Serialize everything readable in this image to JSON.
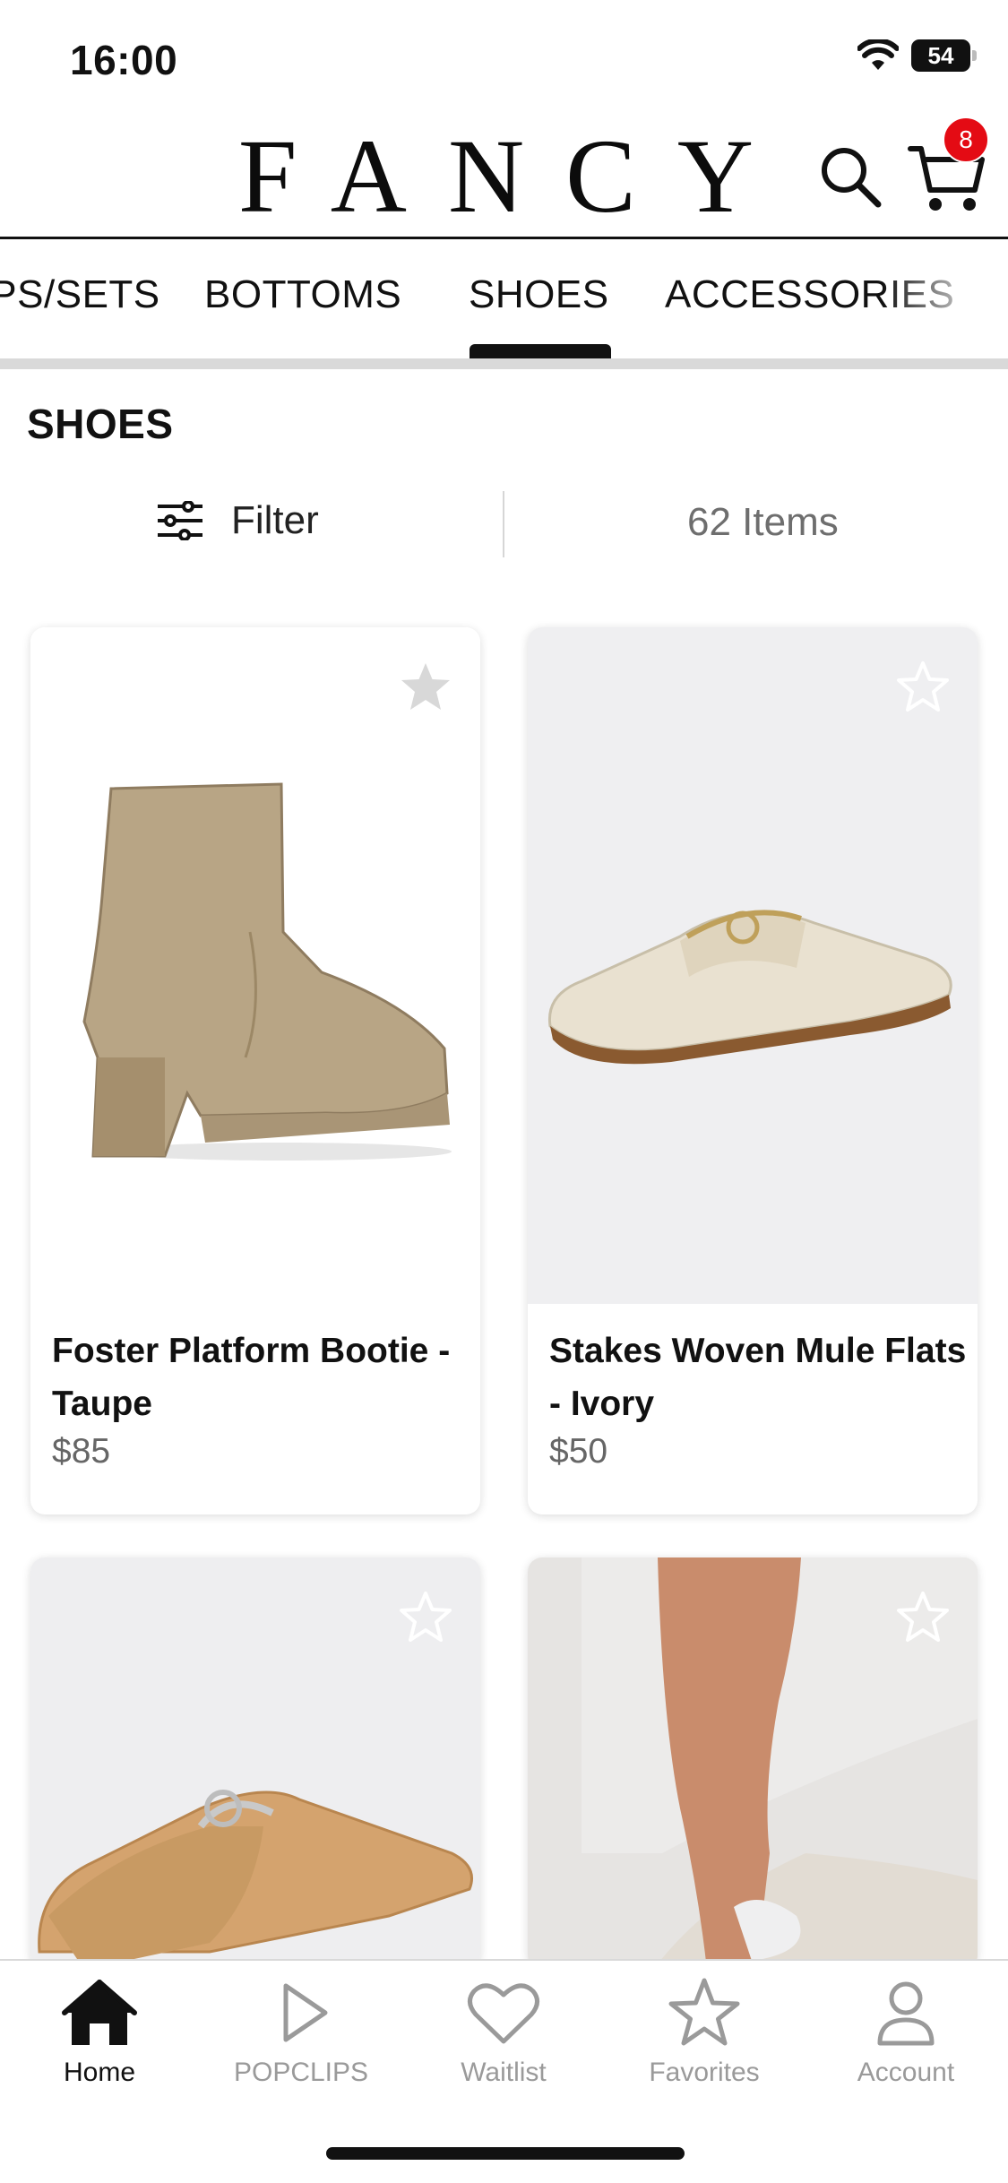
{
  "status_bar": {
    "time": "16:00",
    "battery": "54"
  },
  "header": {
    "logo": "FANCY",
    "cart_count": "8"
  },
  "tabs": [
    {
      "label": "TOPS/SETS"
    },
    {
      "label": "BOTTOMS"
    },
    {
      "label": "SHOES",
      "active": true
    },
    {
      "label": "ACCESSORIES"
    }
  ],
  "section": {
    "title": "SHOES",
    "filter_label": "Filter",
    "item_count": "62 Items"
  },
  "products": [
    {
      "name": "Foster Platform Bootie - Taupe",
      "price": "$85"
    },
    {
      "name": "Stakes Woven Mule Flats - Ivory",
      "price": "$50"
    },
    {
      "name": "",
      "price": ""
    },
    {
      "name": "",
      "price": ""
    }
  ],
  "bottom_nav": [
    {
      "label": "Home",
      "icon": "home-icon",
      "active": true
    },
    {
      "label": "POPCLIPS",
      "icon": "play-icon"
    },
    {
      "label": "Waitlist",
      "icon": "heart-icon"
    },
    {
      "label": "Favorites",
      "icon": "star-icon"
    },
    {
      "label": "Account",
      "icon": "user-icon"
    }
  ],
  "colors": {
    "badge": "#e40b14",
    "text": "#111111",
    "muted": "#9a9a9a",
    "bootie": "#b8a585",
    "mule_ivory": "#e9e1d0",
    "mule_tan": "#d4a36e"
  }
}
